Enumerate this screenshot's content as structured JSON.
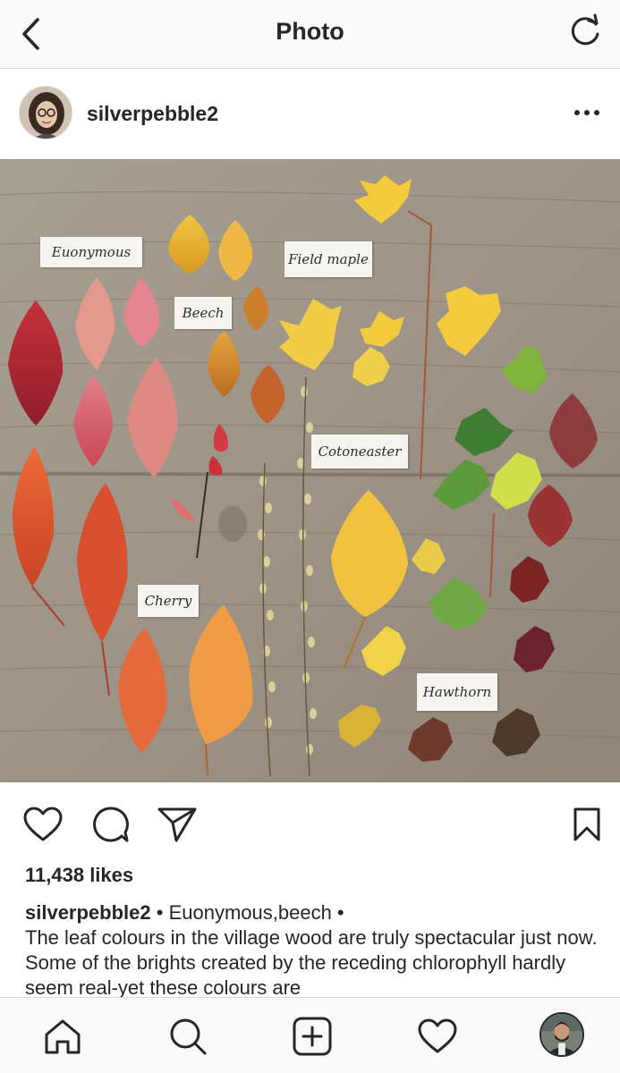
{
  "header": {
    "title": "Photo",
    "back_icon": "chevron-left-icon",
    "refresh_icon": "refresh-icon"
  },
  "post": {
    "username": "silverpebble2",
    "more_icon": "more-horizontal-icon",
    "photo_labels": {
      "euonymous": "Euonymous",
      "field_maple": "Field maple",
      "beech": "Beech",
      "cotoneaster": "Cotoneaster",
      "cherry": "Cherry",
      "hawthorn": "Hawthorn"
    },
    "likes": "11,438 likes",
    "caption_username": "silverpebble2",
    "caption_tags": " • Euonymous,beech •",
    "caption_text": "The leaf colours in the village wood are truly spectacular just now. Some of the brights created by the receding chlorophyll hardly seem real-yet these colours are"
  },
  "actions": {
    "like_icon": "heart-icon",
    "comment_icon": "comment-icon",
    "share_icon": "send-icon",
    "save_icon": "bookmark-icon"
  },
  "bottom_nav": {
    "home_icon": "home-icon",
    "search_icon": "search-icon",
    "add_icon": "add-post-icon",
    "activity_icon": "heart-icon",
    "profile_icon": "profile-avatar"
  },
  "colors": {
    "background": "#ffffff",
    "bar_background": "#fafafa",
    "text": "#262626",
    "border": "#dbdbdb",
    "wood": "#a2998c"
  }
}
